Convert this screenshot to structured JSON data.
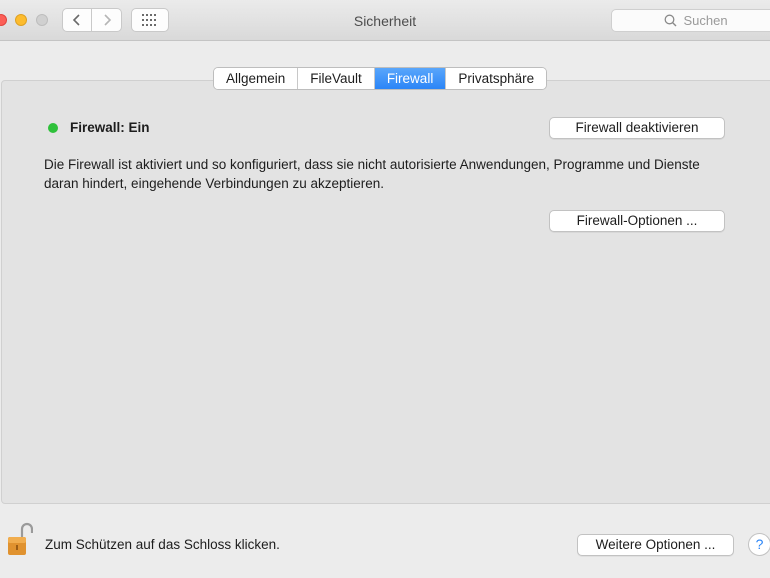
{
  "window": {
    "title": "Sicherheit",
    "search_placeholder": "Suchen"
  },
  "tabs": [
    {
      "label": "Allgemein",
      "active": false
    },
    {
      "label": "FileVault",
      "active": false
    },
    {
      "label": "Firewall",
      "active": true
    },
    {
      "label": "Privatsphäre",
      "active": false
    }
  ],
  "firewall": {
    "status_label": "Firewall: Ein",
    "status_color": "#2fc13b",
    "deactivate_button": "Firewall deaktivieren",
    "description": "Die Firewall ist aktiviert und so konfiguriert, dass sie nicht autorisierte Anwendungen, Programme und Dienste daran hindert, eingehende Verbindungen zu akzeptieren.",
    "options_button": "Firewall-Optionen ..."
  },
  "footer": {
    "lock_text": "Zum Schützen auf das Schloss klicken.",
    "more_options_button": "Weitere Optionen ...",
    "help_label": "?"
  },
  "icons": {
    "back": "chevron-left-icon",
    "forward": "chevron-right-icon",
    "grid": "grid-icon",
    "search": "search-icon",
    "lock": "lock-open-icon"
  }
}
